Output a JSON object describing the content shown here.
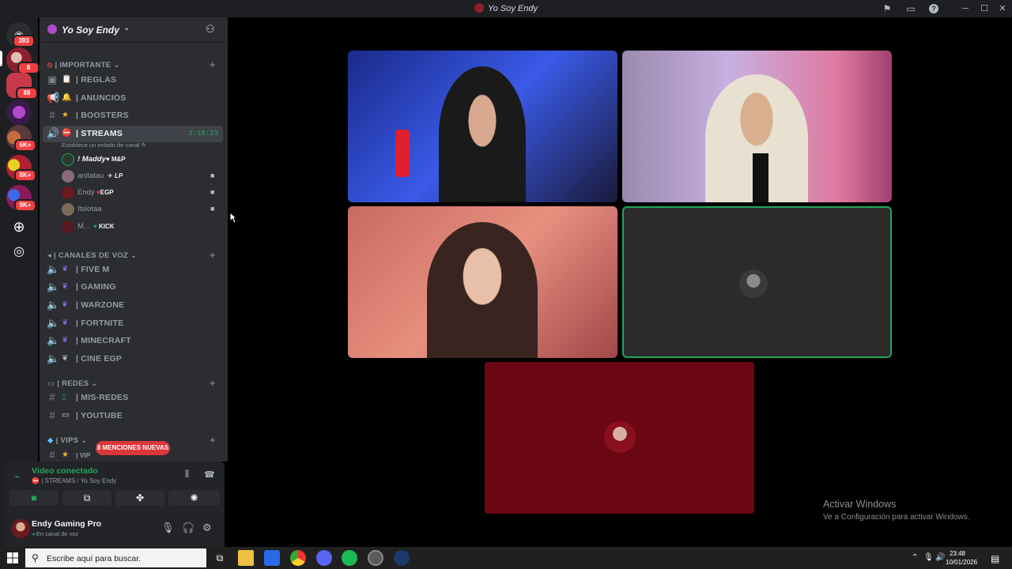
{
  "window": {
    "title": "Yo Soy Endy"
  },
  "rail": {
    "dm_badge": "393",
    "badges": [
      "8",
      "88",
      "6K+",
      "8K+",
      "9K+"
    ]
  },
  "server": {
    "name": "Yo Soy Endy"
  },
  "categories": {
    "importante": "| IMPORTANTE",
    "voz": "| CANALES DE VOZ",
    "redes": "| REDES",
    "vips": "| VIPS"
  },
  "channels": {
    "reglas": "| REGLAS",
    "anuncios": "| ANUNCIOS",
    "boosters": "| BOOSTERS",
    "streams": "| STREAMS",
    "streams_timer": "3:10:23",
    "streams_status": "Establece un estado de canal",
    "fivem": "| FIVE M",
    "gaming": "| GAMING",
    "warzone": "| WARZONE",
    "fortnite": "| FORTNITE",
    "minecraft": "| MINECRAFT",
    "cine": "| CINE EGP",
    "misredes": "| MIS-REDES",
    "youtube": "| YOUTUBE",
    "vip": "| VIP"
  },
  "voice_users": [
    {
      "name": "! Maddy",
      "badge": "M&P"
    },
    {
      "name": "anitalau",
      "badge": "LP"
    },
    {
      "name": "Endy",
      "badge": "EGP"
    },
    {
      "name": "Itslotaa",
      "badge": ""
    },
    {
      "name": "M...",
      "badge": "KICK"
    }
  ],
  "mentions_pill": "8 MENCIONES NUEVAS",
  "voice_panel": {
    "status": "Video conectado",
    "channel": "| STREAMS / Yo Soy Endy"
  },
  "user_panel": {
    "name": "Endy Gaming Pro",
    "status": "En canal de voz"
  },
  "activation": {
    "line1": "Activar Windows",
    "line2": "Ve a Configuración para activar Windows."
  },
  "taskbar": {
    "search_placeholder": "Escribe aquí para buscar.",
    "time": "23:48",
    "date": "10/01/2026"
  },
  "colors": {
    "accent_green": "#23a55a",
    "mention_red": "#da373c",
    "stage_tile_red": "#6b0712"
  }
}
